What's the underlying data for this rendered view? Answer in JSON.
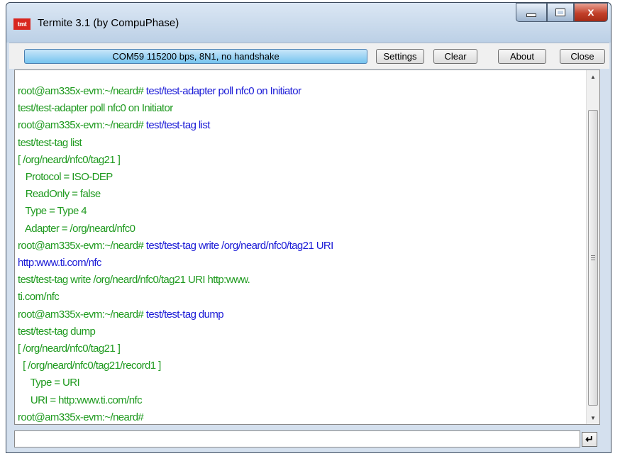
{
  "window": {
    "app_icon_text": "tmt",
    "title": "Termite 3.1 (by CompuPhase)",
    "close_glyph": "x"
  },
  "toolbar": {
    "status": "COM59 115200 bps, 8N1, no handshake",
    "settings_label": "Settings",
    "clear_label": "Clear",
    "about_label": "About",
    "close_label": "Close"
  },
  "colors": {
    "echo_text": "#1f9a1f",
    "typed_text": "#1a1ad6"
  },
  "terminal": {
    "lines": [
      {
        "segments": [
          {
            "text": "root@am335x-evm:~/neard# ",
            "color": "green"
          },
          {
            "text": "test/test-adapter poll nfc0 on Initiator",
            "color": "blue"
          }
        ]
      },
      {
        "segments": [
          {
            "text": "test/test-adapter poll nfc0 on Initiator",
            "color": "green"
          }
        ]
      },
      {
        "segments": [
          {
            "text": "root@am335x-evm:~/neard# ",
            "color": "green"
          },
          {
            "text": "test/test-tag list",
            "color": "blue"
          }
        ]
      },
      {
        "segments": [
          {
            "text": "test/test-tag list",
            "color": "green"
          }
        ]
      },
      {
        "segments": [
          {
            "text": "[ /org/neard/nfc0/tag21 ]",
            "color": "green"
          }
        ]
      },
      {
        "segments": [
          {
            "text": "   Protocol = ISO-DEP",
            "color": "green"
          }
        ]
      },
      {
        "segments": [
          {
            "text": "   ReadOnly = false",
            "color": "green"
          }
        ]
      },
      {
        "segments": [
          {
            "text": "   Type = Type 4",
            "color": "green"
          }
        ]
      },
      {
        "segments": [
          {
            "text": "   Adapter = /org/neard/nfc0",
            "color": "green"
          }
        ]
      },
      {
        "segments": [
          {
            "text": "root@am335x-evm:~/neard# ",
            "color": "green"
          },
          {
            "text": "test/test-tag write /org/neard/nfc0/tag21 URI",
            "color": "blue"
          }
        ]
      },
      {
        "segments": [
          {
            "text": "http:www.ti.com/nfc",
            "color": "blue"
          }
        ]
      },
      {
        "segments": [
          {
            "text": "test/test-tag write /org/neard/nfc0/tag21 URI http:www.",
            "color": "green"
          }
        ]
      },
      {
        "segments": [
          {
            "text": "ti.com/nfc",
            "color": "green"
          }
        ]
      },
      {
        "segments": [
          {
            "text": "root@am335x-evm:~/neard# ",
            "color": "green"
          },
          {
            "text": "test/test-tag dump",
            "color": "blue"
          }
        ]
      },
      {
        "segments": [
          {
            "text": "test/test-tag dump",
            "color": "green"
          }
        ]
      },
      {
        "segments": [
          {
            "text": "[ /org/neard/nfc0/tag21 ]",
            "color": "green"
          }
        ]
      },
      {
        "segments": [
          {
            "text": "  [ /org/neard/nfc0/tag21/record1 ]",
            "color": "green"
          }
        ]
      },
      {
        "segments": [
          {
            "text": "     Type = URI",
            "color": "green"
          }
        ]
      },
      {
        "segments": [
          {
            "text": "     URI = http:www.ti.com/nfc",
            "color": "green"
          }
        ]
      },
      {
        "segments": [
          {
            "text": "root@am335x-evm:~/neard# ",
            "color": "green"
          }
        ]
      }
    ]
  },
  "input": {
    "value": "",
    "enter_glyph": "↵"
  }
}
